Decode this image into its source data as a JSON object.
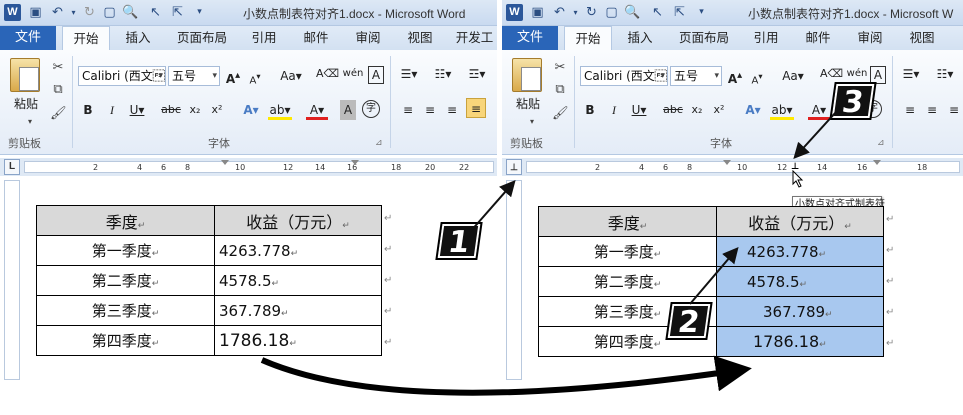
{
  "left": {
    "title": "小数点制表符对齐1.docx  -  Microsoft Word",
    "tabs": [
      "文件",
      "开始",
      "插入",
      "页面布局",
      "引用",
      "邮件",
      "审阅",
      "视图",
      "开发工"
    ],
    "ribbon": {
      "paste_label": "粘贴",
      "clipboard_label": "剪贴板",
      "font_name": "Calibri (西文\u001c",
      "font_size": "五号",
      "font_group_label": "字体"
    },
    "ruler_numbers": [
      "2",
      "2",
      "4",
      "6",
      "8",
      "10",
      "12",
      "14",
      "16",
      "18",
      "20",
      "22"
    ],
    "table": {
      "header": [
        "季度",
        "收益（万元）"
      ],
      "rows": [
        [
          "第一季度",
          "4263.778"
        ],
        [
          "第二季度",
          "4578.5"
        ],
        [
          "第三季度",
          "367.789"
        ],
        [
          "第四季度",
          "1786.18"
        ]
      ]
    }
  },
  "right": {
    "title": "小数点制表符对齐1.docx  -  Microsoft W",
    "tabs": [
      "文件",
      "开始",
      "插入",
      "页面布局",
      "引用",
      "邮件",
      "审阅",
      "视图"
    ],
    "ribbon": {
      "paste_label": "粘贴",
      "clipboard_label": "剪贴板",
      "font_name": "Calibri (西文\u001c",
      "font_size": "五号",
      "font_group_label": "字体"
    },
    "ruler_numbers": [
      "2",
      "2",
      "4",
      "6",
      "8",
      "10",
      "12",
      "14",
      "16",
      "18"
    ],
    "tooltip": "小数点对齐式制表符",
    "table": {
      "header": [
        "季度",
        "收益（万元）"
      ],
      "rows": [
        [
          "第一季度",
          "4263.778"
        ],
        [
          "第二季度",
          "4578.5"
        ],
        [
          "第三季度",
          "367.789"
        ],
        [
          "第四季度",
          "1786.18"
        ]
      ]
    },
    "highlight_color": "#a8c8ef"
  },
  "badges": {
    "one": "1",
    "two": "2",
    "three": "3"
  },
  "colors": {
    "file_tab": "#2a65b8",
    "ribbon_bg": "#e4ecf7",
    "table_header": "#d9d9d9"
  }
}
